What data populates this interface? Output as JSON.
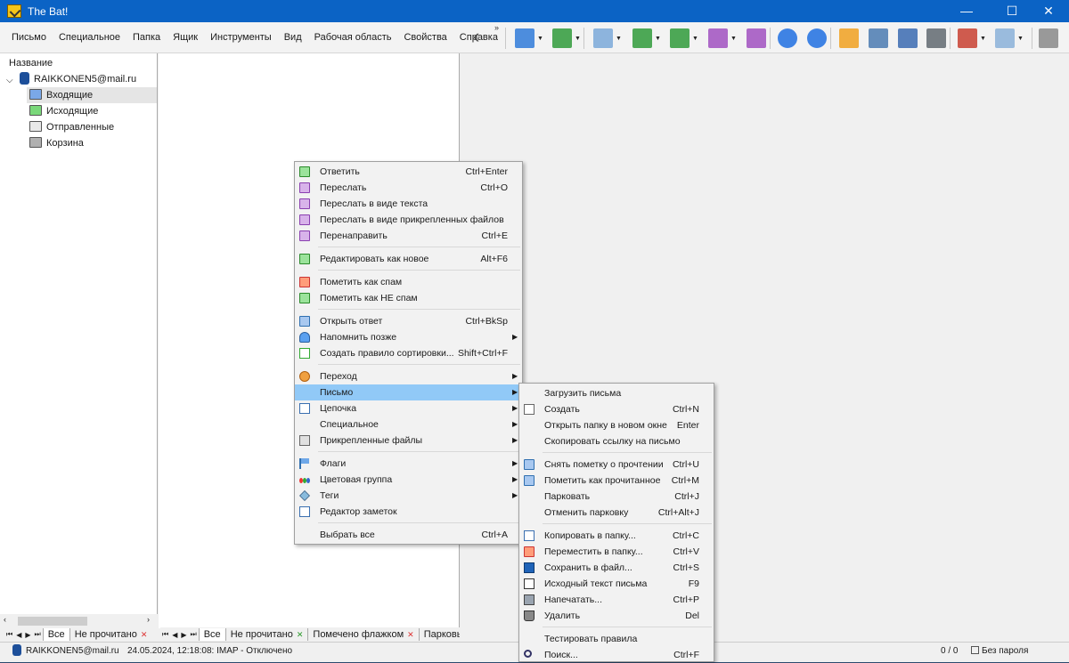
{
  "window": {
    "title": "The Bat!",
    "minimize": "—",
    "maximize": "☐",
    "close": "✕"
  },
  "menubar": [
    "Письмо",
    "Специальное",
    "Папка",
    "Ящик",
    "Инструменты",
    "Вид",
    "Рабочая область",
    "Свойства",
    "Справка"
  ],
  "toolbar": {
    "more": "»",
    "buttons": [
      {
        "icon": "get-mail-icon",
        "dropdown": true
      },
      {
        "icon": "send-mail-icon",
        "dropdown": true
      },
      {
        "icon": "new-message-icon",
        "dropdown": true
      },
      {
        "icon": "reply-icon",
        "dropdown": true
      },
      {
        "icon": "reply-all-icon",
        "dropdown": true
      },
      {
        "icon": "forward-icon",
        "dropdown": true
      },
      {
        "icon": "redirect-icon",
        "dropdown": false
      },
      {
        "icon": "previous-arrow-icon",
        "dropdown": false
      },
      {
        "icon": "next-arrow-icon",
        "dropdown": false
      },
      {
        "icon": "address-book-icon",
        "dropdown": false
      },
      {
        "icon": "find-icon",
        "dropdown": false
      },
      {
        "icon": "save-message-icon",
        "dropdown": false
      },
      {
        "icon": "print-icon",
        "dropdown": false
      },
      {
        "icon": "move-to-folder-icon",
        "dropdown": true
      },
      {
        "icon": "copy-to-folder-icon",
        "dropdown": true
      },
      {
        "icon": "delete-icon",
        "dropdown": false
      }
    ]
  },
  "folders": {
    "header": "Название",
    "account": "RAIKKONEN5@mail.ru",
    "items": [
      "Входящие",
      "Исходящие",
      "Отправленные",
      "Корзина"
    ],
    "selected": "Входящие"
  },
  "folder_tabs": [
    "Все",
    "Не прочитано"
  ],
  "list_tabs": [
    "Все",
    "Не прочитано",
    "Помечено флажком",
    "Парковы"
  ],
  "status": {
    "account": "RAIKKONEN5@mail.ru",
    "connection": "24.05.2024, 12:18:08: IMAP  - Отключено",
    "counter": "0 / 0",
    "password": "Без пароля"
  },
  "context_menu": {
    "groups": [
      [
        {
          "label": "Ответить",
          "shortcut": "Ctrl+Enter",
          "icon": "reply-icon"
        },
        {
          "label": "Переслать",
          "shortcut": "Ctrl+O",
          "icon": "forward-icon"
        },
        {
          "label": "Переслать в виде текста",
          "shortcut": "",
          "icon": "forward-text-icon"
        },
        {
          "label": "Переслать в виде прикрепленных файлов",
          "shortcut": "",
          "icon": "forward-attachments-icon"
        },
        {
          "label": "Перенаправить",
          "shortcut": "Ctrl+E",
          "icon": "redirect-icon"
        }
      ],
      [
        {
          "label": "Редактировать как новое",
          "shortcut": "Alt+F6",
          "icon": "edit-as-new-icon"
        }
      ],
      [
        {
          "label": "Пометить как спам",
          "shortcut": "",
          "icon": "spam-icon"
        },
        {
          "label": "Пометить как НЕ спам",
          "shortcut": "",
          "icon": "not-spam-icon"
        }
      ],
      [
        {
          "label": "Открыть ответ",
          "shortcut": "Ctrl+BkSp",
          "icon": "open-reply-icon"
        },
        {
          "label": "Напомнить позже",
          "shortcut": "",
          "icon": "remind-later-icon",
          "submenu": true
        },
        {
          "label": "Создать правило сортировки...",
          "shortcut": "Shift+Ctrl+F",
          "icon": "sort-rule-icon"
        }
      ],
      [
        {
          "label": "Переход",
          "shortcut": "",
          "icon": "goto-icon",
          "submenu": true
        },
        {
          "label": "Письмо",
          "shortcut": "",
          "icon": "",
          "submenu": true,
          "highlighted": true
        },
        {
          "label": "Цепочка",
          "shortcut": "",
          "icon": "thread-icon",
          "submenu": true
        },
        {
          "label": "Специальное",
          "shortcut": "",
          "icon": "",
          "submenu": true
        },
        {
          "label": "Прикрепленные файлы",
          "shortcut": "",
          "icon": "attachments-icon",
          "submenu": true
        }
      ],
      [
        {
          "label": "Флаги",
          "shortcut": "",
          "icon": "flag-icon",
          "submenu": true
        },
        {
          "label": "Цветовая группа",
          "shortcut": "",
          "icon": "color-group-icon",
          "submenu": true
        },
        {
          "label": "Теги",
          "shortcut": "",
          "icon": "tag-icon",
          "submenu": true
        },
        {
          "label": "Редактор заметок",
          "shortcut": "",
          "icon": "notes-editor-icon"
        }
      ],
      [
        {
          "label": "Выбрать все",
          "shortcut": "Ctrl+A",
          "icon": ""
        }
      ]
    ]
  },
  "submenu": {
    "groups": [
      [
        {
          "label": "Загрузить письма",
          "shortcut": "",
          "icon": ""
        },
        {
          "label": "Создать",
          "shortcut": "Ctrl+N",
          "icon": "new-doc-icon"
        },
        {
          "label": "Открыть папку в новом окне",
          "shortcut": "Enter",
          "icon": ""
        },
        {
          "label": "Скопировать ссылку на письмо",
          "shortcut": "",
          "icon": ""
        }
      ],
      [
        {
          "label": "Снять пометку о прочтении",
          "shortcut": "Ctrl+U",
          "icon": "mark-unread-icon"
        },
        {
          "label": "Пометить как прочитанное",
          "shortcut": "Ctrl+M",
          "icon": "mark-read-icon"
        },
        {
          "label": "Парковать",
          "shortcut": "Ctrl+J",
          "icon": ""
        },
        {
          "label": "Отменить парковку",
          "shortcut": "Ctrl+Alt+J",
          "icon": ""
        }
      ],
      [
        {
          "label": "Копировать в папку...",
          "shortcut": "Ctrl+C",
          "icon": "copy-folder-icon"
        },
        {
          "label": "Переместить в папку...",
          "shortcut": "Ctrl+V",
          "icon": "move-folder-icon"
        },
        {
          "label": "Сохранить в файл...",
          "shortcut": "Ctrl+S",
          "icon": "save-file-icon"
        },
        {
          "label": "Исходный текст письма",
          "shortcut": "F9",
          "icon": "source-text-icon"
        },
        {
          "label": "Напечатать...",
          "shortcut": "Ctrl+P",
          "icon": "print-icon"
        },
        {
          "label": "Удалить",
          "shortcut": "Del",
          "icon": "trash-icon"
        }
      ],
      [
        {
          "label": "Тестировать правила",
          "shortcut": "",
          "icon": ""
        },
        {
          "label": "Поиск...",
          "shortcut": "Ctrl+F",
          "icon": "search-icon"
        }
      ]
    ]
  },
  "colors": {
    "titlebar": "#0b63c5",
    "highlight": "#91c9f7",
    "selected_folder": "#e5e5e5"
  }
}
